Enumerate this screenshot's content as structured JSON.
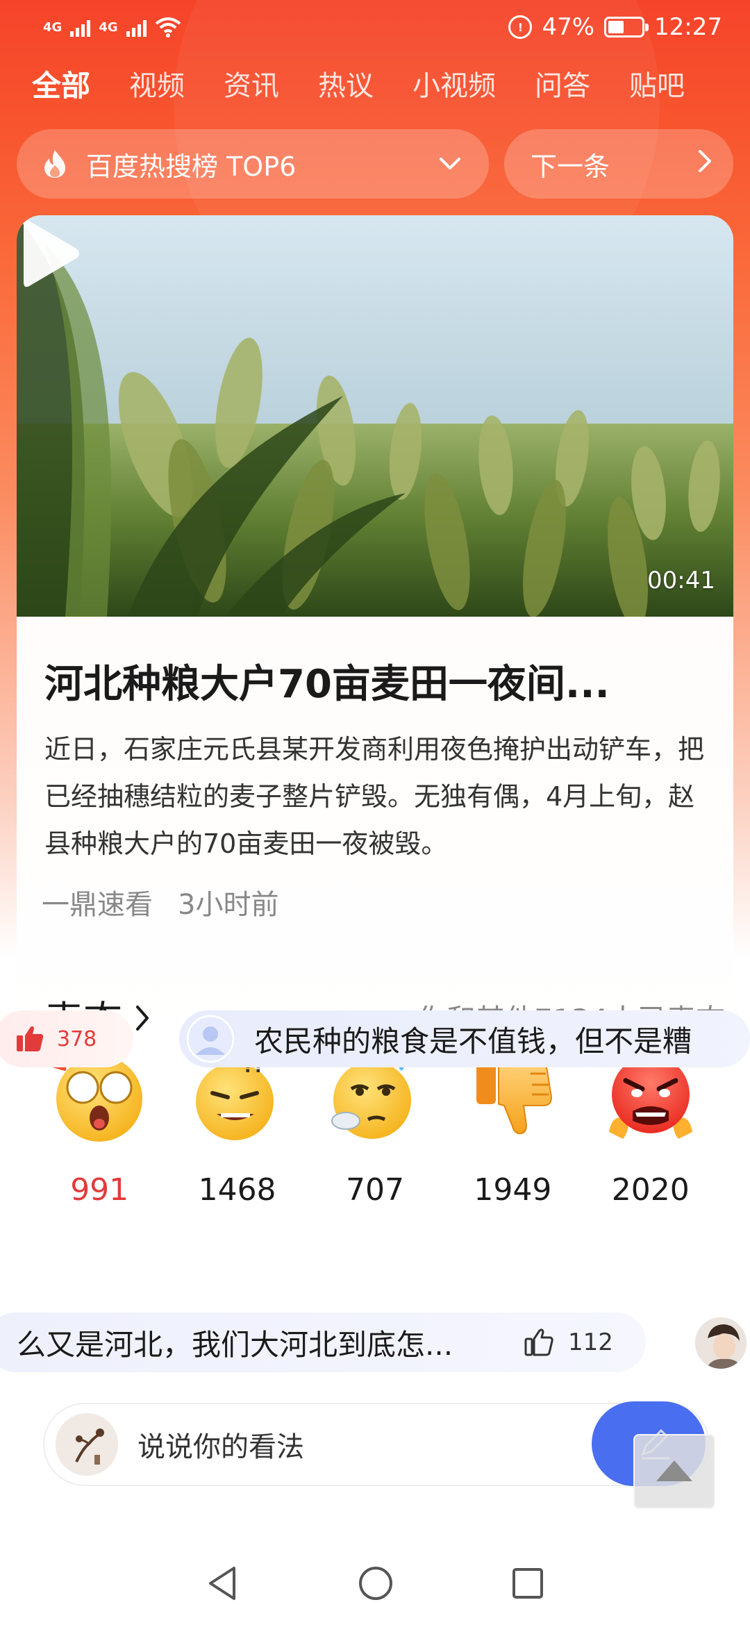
{
  "status_bar": {
    "network_1": "4G",
    "network_2": "4G",
    "battery_percent": "47%",
    "battery_level": 0.47,
    "time": "12:27"
  },
  "tabs": [
    "全部",
    "视频",
    "资讯",
    "热议",
    "小视频",
    "问答",
    "贴吧"
  ],
  "active_tab": "全部",
  "hot_bar": {
    "label": "百度热搜榜 TOP6",
    "next_label": "下一条"
  },
  "video": {
    "duration": "00:41"
  },
  "article": {
    "headline": "河北种粮大户70亩麦田一夜间...",
    "summary": "近日，石家庄元氏县某开发商利用夜色掩护出动铲车，把已经抽穗结粒的麦子整片铲毁。无独有偶，4月上旬，赵县种粮大户的70亩麦田一夜被毁。",
    "source": "一鼎速看",
    "time": "3小时前"
  },
  "reactions": {
    "title": "表态",
    "summary_text": "你和其他7134人已表态",
    "items": [
      {
        "icon": "shocked-emoji-icon",
        "count": "991",
        "highlight": true
      },
      {
        "icon": "dizzy-emoji-icon",
        "count": "1468",
        "highlight": false
      },
      {
        "icon": "speechless-emoji-icon",
        "count": "707",
        "highlight": false
      },
      {
        "icon": "thumbs-down-icon",
        "count": "1949",
        "highlight": false
      },
      {
        "icon": "angry-emoji-icon",
        "count": "2020",
        "highlight": false
      }
    ]
  },
  "comments": {
    "row1_likes": "378",
    "row1_text": "农民种的粮食是不值钱，但不是糟",
    "row2_text": "么又是河北，我们大河北到底怎...",
    "row2_likes": "112"
  },
  "input": {
    "placeholder": "说说你的看法"
  },
  "colors": {
    "brand_red": "#f5432a",
    "send_blue": "#4a6ef0",
    "highlight_red": "#e33a3a"
  }
}
